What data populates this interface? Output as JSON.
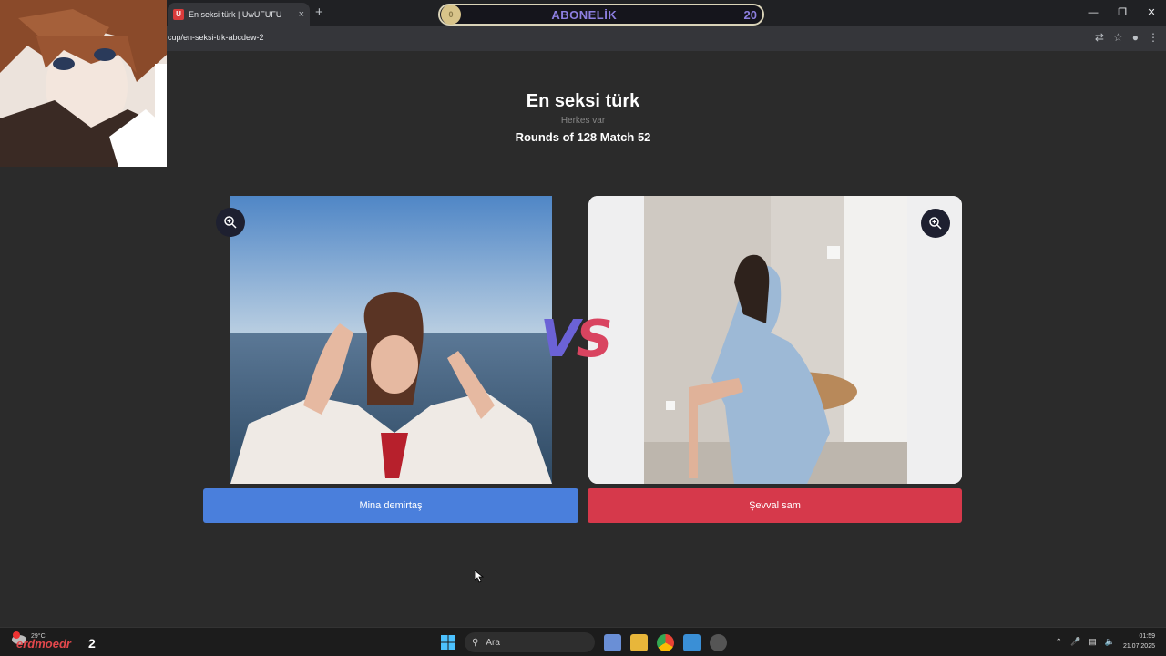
{
  "browser": {
    "tab_title": "En seksi türk | UwUFUFU",
    "tab_favicon": "U",
    "url": "cup/en-seksi-trk-abcdew-2",
    "close_glyph": "×",
    "newtab_glyph": "+"
  },
  "subscription_overlay": {
    "label": "ABONELİK",
    "count": "20",
    "coin_value": "0"
  },
  "page": {
    "title": "En seksi türk",
    "subtitle": "Herkes var",
    "round_info": "Rounds of 128 Match 52"
  },
  "contestants": {
    "left_name": "Mina demirtaş",
    "right_name": "Şevval sam"
  },
  "vs": {
    "v": "V",
    "s": "S"
  },
  "taskbar": {
    "temperature": "29°C",
    "weather_badge": "1",
    "streamer_name": "erdmoedr",
    "streamer_count": "2",
    "search_placeholder": "Ara",
    "time": "01:59",
    "date": "21.07.2025"
  },
  "colors": {
    "accent_blue": "#4a7fdc",
    "accent_red": "#d6394b",
    "background": "#2b2b2b"
  }
}
